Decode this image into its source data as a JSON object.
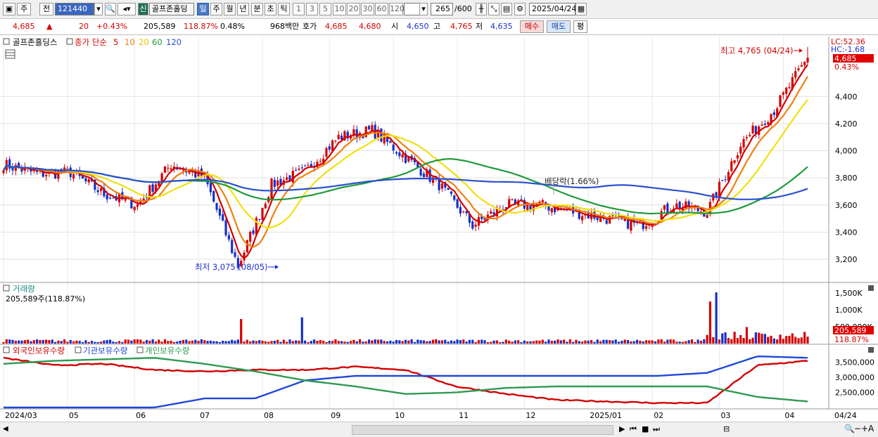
{
  "toolbar": {
    "type_label": "주",
    "prev_label": "전",
    "code": "121440",
    "badge": "신",
    "stock_name": "골프존홀딩",
    "period_tabs": [
      "일",
      "주",
      "월",
      "년",
      "분",
      "초",
      "틱"
    ],
    "active_period": "일",
    "intervals": [
      "1",
      "3",
      "5",
      "10",
      "20",
      "30",
      "60",
      "120"
    ],
    "count": "265",
    "count_total": "/600",
    "date": "2025/04/24"
  },
  "quote": {
    "price": "4,685",
    "change_symbol": "▲",
    "change": "20",
    "change_pct": "+0.43%",
    "volume": "205,589",
    "volume_ratio": "118.87%",
    "turnover_ratio": "0.48%",
    "amount": "968백만",
    "ask_label": "호가",
    "ask1": "4,685",
    "ask2": "4,680",
    "open_label": "시",
    "open": "4,650",
    "high_label": "고",
    "high": "4,765",
    "low_label": "저",
    "low": "4,635",
    "buy_label": "매수",
    "sell_label": "매도",
    "eval_label": "평"
  },
  "price_panel": {
    "title": "골프존홀딩스",
    "ma_label": "종가 단순",
    "ma_periods": [
      "5",
      "10",
      "20",
      "60",
      "120"
    ],
    "lc_label": "LC:52.36",
    "hc_label": "HC:-1.68",
    "current_tag": "4,685",
    "current_pct": "0.43%",
    "max_annotation": "최고 4,765 (04/24)",
    "min_annotation": "최저 3,075 (08/05)",
    "dividend_annotation": "배당락(1.66%)"
  },
  "volume_panel": {
    "title": "거래량",
    "info": "205,589주(118.87%)",
    "current_tag": "205,589",
    "current_pct": "118.87%"
  },
  "holding_panel": {
    "legend": [
      "외국인보유수량",
      "기관보유수량",
      "개인보유수량"
    ]
  },
  "x_axis_labels": [
    "2024/03",
    "05",
    "06",
    "07",
    "08",
    "09",
    "10",
    "11",
    "12",
    "2025/01",
    "02",
    "03",
    "04"
  ],
  "x_axis_end": "04/24",
  "colors": {
    "up": "#d40000",
    "down": "#1530c8",
    "ma5": "#d40000",
    "ma10": "#f08010",
    "ma20": "#f0e010",
    "ma60": "#1f9a3a",
    "ma120": "#2a50d0",
    "foreign": "#d40000",
    "institution": "#1f48d8",
    "individual": "#2e9a52"
  },
  "chart_data": [
    {
      "type": "candlestick",
      "title": "골프존홀딩스",
      "x_labels": [
        "2024/03",
        "05",
        "06",
        "07",
        "08",
        "09",
        "10",
        "11",
        "12",
        "2025/01",
        "02",
        "03",
        "04"
      ],
      "y_ticks": [
        3200,
        3400,
        3600,
        3800,
        4000,
        4200,
        4400
      ],
      "ylim": [
        3050,
        4800
      ],
      "price_keypoints": {
        "dates": [
          "2024/03",
          "04",
          "05",
          "06",
          "06/20",
          "07",
          "07/25",
          "08/05",
          "08/20",
          "09",
          "09/15",
          "10",
          "10/15",
          "11",
          "11/20",
          "12",
          "12/20",
          "2025/01",
          "01/20",
          "02",
          "02/20",
          "03",
          "03/15",
          "04",
          "04/24"
        ],
        "close": [
          3900,
          3830,
          3840,
          3680,
          3600,
          3900,
          3800,
          3150,
          3750,
          3850,
          4100,
          4150,
          3950,
          3750,
          3450,
          3600,
          3600,
          3550,
          3500,
          3450,
          3600,
          3550,
          4050,
          4300,
          4685
        ]
      },
      "series_ma": [
        {
          "name": "5",
          "period": 5
        },
        {
          "name": "10",
          "period": 10
        },
        {
          "name": "20",
          "period": 20
        },
        {
          "name": "60",
          "period": 60
        },
        {
          "name": "120",
          "period": 120
        }
      ],
      "last": {
        "open": 4650,
        "high": 4765,
        "low": 4635,
        "close": 4685
      },
      "max": {
        "value": 4765,
        "date": "04/24"
      },
      "min": {
        "value": 3075,
        "date": "08/05"
      }
    },
    {
      "type": "bar",
      "title": "거래량",
      "y_ticks": [
        "500,000K",
        "1,000K",
        "1,500K"
      ],
      "y_tick_values": [
        500000,
        1000000,
        1500000
      ],
      "ylim": [
        0,
        1650000
      ],
      "last_value": 205589,
      "spikes": [
        {
          "date": "08/05",
          "value": 730000
        },
        {
          "date": "09/02",
          "value": 780000
        },
        {
          "date": "03/13",
          "value": 1250000
        },
        {
          "date": "03/14",
          "value": 1520000
        },
        {
          "date": "04/02",
          "value": 490000
        }
      ]
    },
    {
      "type": "line",
      "title": "보유수량",
      "y_ticks": [
        "2,500,000",
        "3,000,000",
        "3,500,000"
      ],
      "y_tick_values": [
        2500000,
        3000000,
        3500000
      ],
      "ylim": [
        2000000,
        3750000
      ],
      "series": [
        {
          "name": "외국인보유수량",
          "keypoints": [
            3650000,
            3400000,
            3450000,
            3250000,
            3200000,
            3250000,
            3250000,
            3350000,
            3250000,
            2700000,
            2450000,
            2250000,
            2200000,
            2150000,
            2150000,
            3400000,
            3550000
          ]
        },
        {
          "name": "기관보유수량",
          "keypoints": [
            2000000,
            2000000,
            2000000,
            2000000,
            2300000,
            2300000,
            2900000,
            3050000,
            3050000,
            3050000,
            3050000,
            3050000,
            3050000,
            3050000,
            3150000,
            3700000,
            3650000
          ]
        },
        {
          "name": "개인보유수량",
          "keypoints": [
            3450000,
            3550000,
            3600000,
            3650000,
            3450000,
            3200000,
            2900000,
            2700000,
            2450000,
            2500000,
            2650000,
            2700000,
            2700000,
            2700000,
            2700000,
            2350000,
            2200000
          ]
        }
      ]
    }
  ]
}
